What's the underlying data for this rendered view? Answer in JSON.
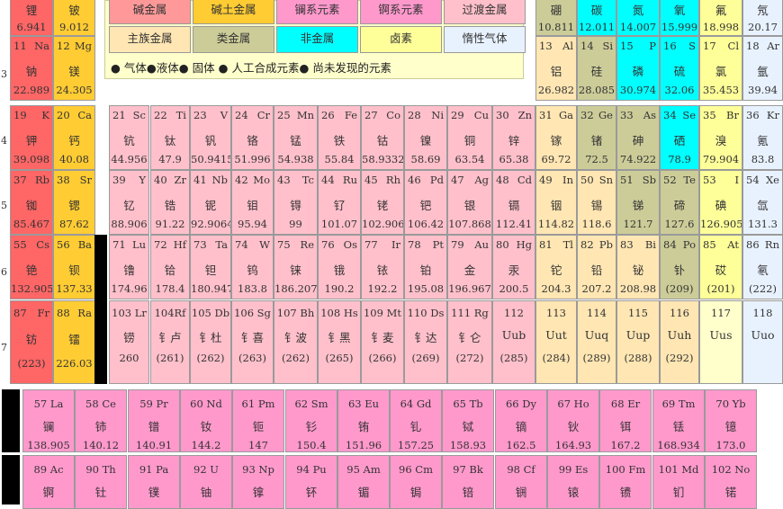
{
  "colors": {
    "alkali": "#ff9999",
    "alkaline_earth": "#ffcc33",
    "lanthanide": "#ff99cc",
    "actinide": "#ff99cc",
    "transition": "#ffc0cb",
    "post_transition": "#ccccaa",
    "metalloid": "#cccc99",
    "nonmetal": "#00ffff",
    "halogen": "#ffff99",
    "noble": "#c0e0ff",
    "hydrogen_yellow": "#ffffcc",
    "undiscovered": "#ffe6b3",
    "bottom_row": "#ff99cc"
  },
  "legend": {
    "categories": [
      {
        "label": "碱金属",
        "color": "#ff9999"
      },
      {
        "label": "碱土金属",
        "color": "#ffcc33"
      },
      {
        "label": "镧系元素",
        "color": "#ff99cc"
      },
      {
        "label": "锕系元素",
        "color": "#ff99cc"
      },
      {
        "label": "过渡金属",
        "color": "#ffc0cb"
      },
      {
        "label": "主族金属",
        "color": "#ffe6b3"
      },
      {
        "label": "类金属",
        "color": "#cccc99"
      },
      {
        "label": "非金属",
        "color": "#00ffff"
      },
      {
        "label": "卤素",
        "color": "#ffff99"
      },
      {
        "label": "惰性气体",
        "color": "#e8f2ff"
      }
    ],
    "states_text": "● 气体●液体●  固体  ●  人工合成元素●  尚未发现的元素"
  },
  "row_labels": [
    "3",
    "4",
    "5",
    "6",
    "7"
  ],
  "top_partial": [
    {
      "name": "锂",
      "mass": "6.941",
      "color": "#ff6666"
    },
    {
      "name": "铍",
      "mass": "9.012",
      "color": "#ffcc33"
    },
    {
      "name": "硼",
      "mass": "10.811",
      "color": "#cccc99"
    },
    {
      "name": "碳",
      "mass": "12.011",
      "color": "#00ffff"
    },
    {
      "name": "氮",
      "mass": "14.007",
      "color": "#00ffff"
    },
    {
      "name": "氧",
      "mass": "15.999",
      "color": "#00ffff"
    },
    {
      "name": "氟",
      "mass": "18.998",
      "color": "#ffff99"
    },
    {
      "name": "氖",
      "mass": "20.17",
      "color": "#e8f2ff"
    }
  ],
  "period3": [
    {
      "num": "11",
      "sym": "Na",
      "name": "钠",
      "mass": "22.989",
      "color": "#ff6666"
    },
    {
      "num": "12",
      "sym": "Mg",
      "name": "镁",
      "mass": "24.305",
      "color": "#ffcc33"
    },
    {
      "num": "13",
      "sym": "Al",
      "name": "铝",
      "mass": "26.982",
      "color": "#ffe6b3"
    },
    {
      "num": "14",
      "sym": "Si",
      "name": "硅",
      "mass": "28.085",
      "color": "#cccc99"
    },
    {
      "num": "15",
      "sym": "P",
      "name": "磷",
      "mass": "30.974",
      "color": "#00ffff"
    },
    {
      "num": "16",
      "sym": "S",
      "name": "硫",
      "mass": "32.06",
      "color": "#00ffff"
    },
    {
      "num": "17",
      "sym": "Cl",
      "name": "氯",
      "mass": "35.453",
      "color": "#ffff99"
    },
    {
      "num": "18",
      "sym": "Ar",
      "name": "氩",
      "mass": "39.94",
      "color": "#e8f2ff"
    }
  ],
  "period4": [
    {
      "num": "19",
      "sym": "K",
      "name": "钾",
      "mass": "39.098",
      "color": "#ff6666"
    },
    {
      "num": "20",
      "sym": "Ca",
      "name": "钙",
      "mass": "40.08",
      "color": "#ffcc33"
    },
    {
      "num": "21",
      "sym": "Sc",
      "name": "钪",
      "mass": "44.956",
      "color": "#ffc0cb"
    },
    {
      "num": "22",
      "sym": "Ti",
      "name": "钛",
      "mass": "47.9",
      "color": "#ffc0cb"
    },
    {
      "num": "23",
      "sym": "V",
      "name": "钒",
      "mass": "50.9415",
      "color": "#ffc0cb"
    },
    {
      "num": "24",
      "sym": "Cr",
      "name": "铬",
      "mass": "51.996",
      "color": "#ffc0cb"
    },
    {
      "num": "25",
      "sym": "Mn",
      "name": "锰",
      "mass": "54.938",
      "color": "#ffc0cb"
    },
    {
      "num": "26",
      "sym": "Fe",
      "name": "铁",
      "mass": "55.84",
      "color": "#ffc0cb"
    },
    {
      "num": "27",
      "sym": "Co",
      "name": "钴",
      "mass": "58.9332",
      "color": "#ffc0cb"
    },
    {
      "num": "28",
      "sym": "Ni",
      "name": "镍",
      "mass": "58.69",
      "color": "#ffc0cb"
    },
    {
      "num": "29",
      "sym": "Cu",
      "name": "铜",
      "mass": "63.54",
      "color": "#ffc0cb"
    },
    {
      "num": "30",
      "sym": "Zn",
      "name": "锌",
      "mass": "65.38",
      "color": "#ffc0cb"
    },
    {
      "num": "31",
      "sym": "Ga",
      "name": "镓",
      "mass": "69.72",
      "color": "#ffe6b3"
    },
    {
      "num": "32",
      "sym": "Ge",
      "name": "锗",
      "mass": "72.5",
      "color": "#cccc99"
    },
    {
      "num": "33",
      "sym": "As",
      "name": "砷",
      "mass": "74.922",
      "color": "#cccc99"
    },
    {
      "num": "34",
      "sym": "Se",
      "name": "硒",
      "mass": "78.9",
      "color": "#00ffff"
    },
    {
      "num": "35",
      "sym": "Br",
      "name": "溴",
      "mass": "79.904",
      "color": "#ffff99"
    },
    {
      "num": "36",
      "sym": "Kr",
      "name": "氪",
      "mass": "83.8",
      "color": "#e8f2ff"
    }
  ],
  "period5": [
    {
      "num": "37",
      "sym": "Rb",
      "name": "铷",
      "mass": "85.467",
      "color": "#ff6666"
    },
    {
      "num": "38",
      "sym": "Sr",
      "name": "锶",
      "mass": "87.62",
      "color": "#ffcc33"
    },
    {
      "num": "39",
      "sym": "Y",
      "name": "钇",
      "mass": "88.906",
      "color": "#ffc0cb"
    },
    {
      "num": "40",
      "sym": "Zr",
      "name": "锆",
      "mass": "91.22",
      "color": "#ffc0cb"
    },
    {
      "num": "41",
      "sym": "Nb",
      "name": "铌",
      "mass": "92.9064",
      "color": "#ffc0cb"
    },
    {
      "num": "42",
      "sym": "Mo",
      "name": "钼",
      "mass": "95.94",
      "color": "#ffc0cb"
    },
    {
      "num": "43",
      "sym": "Tc",
      "name": "锝",
      "mass": "99",
      "color": "#ffc0cb"
    },
    {
      "num": "44",
      "sym": "Ru",
      "name": "钌",
      "mass": "101.07",
      "color": "#ffc0cb"
    },
    {
      "num": "45",
      "sym": "Rh",
      "name": "铑",
      "mass": "102.906",
      "color": "#ffc0cb"
    },
    {
      "num": "46",
      "sym": "Pd",
      "name": "钯",
      "mass": "106.42",
      "color": "#ffc0cb"
    },
    {
      "num": "47",
      "sym": "Ag",
      "name": "银",
      "mass": "107.868",
      "color": "#ffc0cb"
    },
    {
      "num": "48",
      "sym": "Cd",
      "name": "镉",
      "mass": "112.41",
      "color": "#ffc0cb"
    },
    {
      "num": "49",
      "sym": "In",
      "name": "铟",
      "mass": "114.82",
      "color": "#ffe6b3"
    },
    {
      "num": "50",
      "sym": "Sn",
      "name": "锡",
      "mass": "118.6",
      "color": "#ffe6b3"
    },
    {
      "num": "51",
      "sym": "Sb",
      "name": "锑",
      "mass": "121.7",
      "color": "#cccc99"
    },
    {
      "num": "52",
      "sym": "Te",
      "name": "碲",
      "mass": "127.6",
      "color": "#cccc99"
    },
    {
      "num": "53",
      "sym": "I",
      "name": "碘",
      "mass": "126.905",
      "color": "#ffff99"
    },
    {
      "num": "54",
      "sym": "Xe",
      "name": "氙",
      "mass": "131.3",
      "color": "#e8f2ff"
    }
  ],
  "period6": [
    {
      "num": "55",
      "sym": "Cs",
      "name": "铯",
      "mass": "132.905",
      "color": "#ff6666"
    },
    {
      "num": "56",
      "sym": "Ba",
      "name": "钡",
      "mass": "137.33",
      "color": "#ffcc33"
    },
    {
      "num": "71",
      "sym": "Lu",
      "name": "镥",
      "mass": "174.96",
      "color": "#ffc0cb"
    },
    {
      "num": "72",
      "sym": "Hf",
      "name": "铪",
      "mass": "178.4",
      "color": "#ffc0cb"
    },
    {
      "num": "73",
      "sym": "Ta",
      "name": "钽",
      "mass": "180.947",
      "color": "#ffc0cb"
    },
    {
      "num": "74",
      "sym": "W",
      "name": "钨",
      "mass": "183.8",
      "color": "#ffc0cb"
    },
    {
      "num": "75",
      "sym": "Re",
      "name": "铼",
      "mass": "186.207",
      "color": "#ffc0cb"
    },
    {
      "num": "76",
      "sym": "Os",
      "name": "锇",
      "mass": "190.2",
      "color": "#ffc0cb"
    },
    {
      "num": "77",
      "sym": "Ir",
      "name": "铱",
      "mass": "192.2",
      "color": "#ffc0cb"
    },
    {
      "num": "78",
      "sym": "Pt",
      "name": "铂",
      "mass": "195.08",
      "color": "#ffc0cb"
    },
    {
      "num": "79",
      "sym": "Au",
      "name": "金",
      "mass": "196.967",
      "color": "#ffc0cb"
    },
    {
      "num": "80",
      "sym": "Hg",
      "name": "汞",
      "mass": "200.5",
      "color": "#ffc0cb"
    },
    {
      "num": "81",
      "sym": "Tl",
      "name": "铊",
      "mass": "204.3",
      "color": "#ffe6b3"
    },
    {
      "num": "82",
      "sym": "Pb",
      "name": "铅",
      "mass": "207.2",
      "color": "#ffe6b3"
    },
    {
      "num": "83",
      "sym": "Bi",
      "name": "铋",
      "mass": "208.98",
      "color": "#ffe6b3"
    },
    {
      "num": "84",
      "sym": "Po",
      "name": "钋",
      "mass": "(209)",
      "color": "#cccc99"
    },
    {
      "num": "85",
      "sym": "At",
      "name": "砹",
      "mass": "(201)",
      "color": "#ffff99"
    },
    {
      "num": "86",
      "sym": "Rn",
      "name": "氡",
      "mass": "(222)",
      "color": "#e8f2ff"
    }
  ],
  "period7": [
    {
      "num": "87",
      "sym": "Fr",
      "name": "钫",
      "mass": "(223)",
      "color": "#ff6666"
    },
    {
      "num": "88",
      "sym": "Ra",
      "name": "镭",
      "mass": "226.03",
      "color": "#ffcc33"
    },
    {
      "num": "103 Lr",
      "sym": "",
      "name": "铹",
      "mass": "260",
      "color": "#ffc0cb"
    },
    {
      "num": "104Rf",
      "sym": "",
      "name": "钅卢",
      "mass": "(261)",
      "color": "#ffc0cb"
    },
    {
      "num": "105 Db",
      "sym": "",
      "name": "钅杜",
      "mass": "(262)",
      "color": "#ffc0cb"
    },
    {
      "num": "106 Sg",
      "sym": "",
      "name": "钅喜",
      "mass": "(263)",
      "color": "#ffc0cb"
    },
    {
      "num": "107 Bh",
      "sym": "",
      "name": "钅波",
      "mass": "(262)",
      "color": "#ffc0cb"
    },
    {
      "num": "108 Hs",
      "sym": "",
      "name": "钅黑",
      "mass": "(265)",
      "color": "#ffc0cb"
    },
    {
      "num": "109 Mt",
      "sym": "",
      "name": "钅麦",
      "mass": "(266)",
      "color": "#ffc0cb"
    },
    {
      "num": "110 Ds",
      "sym": "",
      "name": "钅达",
      "mass": "(269)",
      "color": "#ffc0cb"
    },
    {
      "num": "111 Rg",
      "sym": "",
      "name": "钅仑",
      "mass": "(272)",
      "color": "#ffc0cb"
    },
    {
      "num": "112",
      "sym": "",
      "name": "Uub",
      "mass": "(285)",
      "color": "#ffc0cb"
    },
    {
      "num": "113",
      "sym": "",
      "name": "Uut",
      "mass": "(284)",
      "color": "#ffe6b3"
    },
    {
      "num": "114",
      "sym": "",
      "name": "Uuq",
      "mass": "(289)",
      "color": "#ffe6b3"
    },
    {
      "num": "115",
      "sym": "",
      "name": "Uup",
      "mass": "(288)",
      "color": "#ffe6b3"
    },
    {
      "num": "116",
      "sym": "",
      "name": "Uuh",
      "mass": "(292)",
      "color": "#ffe6b3"
    },
    {
      "num": "117",
      "sym": "",
      "name": "Uus",
      "mass": "",
      "color": "#ffffcc"
    },
    {
      "num": "118",
      "sym": "",
      "name": "Uuo",
      "mass": "",
      "color": "#e8f2ff"
    }
  ],
  "lanthanides": [
    {
      "num": "57 La",
      "name": "镧",
      "mass": "138.905"
    },
    {
      "num": "58 Ce",
      "name": "铈",
      "mass": "140.12"
    },
    {
      "num": "59 Pr",
      "name": "镨",
      "mass": "140.91"
    },
    {
      "num": "60 Nd",
      "name": "钕",
      "mass": "144.2"
    },
    {
      "num": "61 Pm",
      "name": "钷",
      "mass": "147"
    },
    {
      "num": "62 Sm",
      "name": "钐",
      "mass": "150.4"
    },
    {
      "num": "63 Eu",
      "name": "铕",
      "mass": "151.96"
    },
    {
      "num": "64 Gd",
      "name": "钆",
      "mass": "157.25"
    },
    {
      "num": "65 Tb",
      "name": "铽",
      "mass": "158.93"
    },
    {
      "num": "66 Dy",
      "name": "镝",
      "mass": "162.5"
    },
    {
      "num": "67 Ho",
      "name": "钬",
      "mass": "164.93"
    },
    {
      "num": "68 Er",
      "name": "铒",
      "mass": "167.2"
    },
    {
      "num": "69 Tm",
      "name": "铥",
      "mass": "168.934"
    },
    {
      "num": "70 Yb",
      "name": "镱",
      "mass": "173.0"
    }
  ],
  "actinides": [
    {
      "num": "89 Ac",
      "name": "锕",
      "mass": ""
    },
    {
      "num": "90 Th",
      "name": "钍",
      "mass": ""
    },
    {
      "num": "91 Pa",
      "name": "镤",
      "mass": ""
    },
    {
      "num": "92 U",
      "name": "铀",
      "mass": ""
    },
    {
      "num": "93 Np",
      "name": "镎",
      "mass": ""
    },
    {
      "num": "94 Pu",
      "name": "钚",
      "mass": ""
    },
    {
      "num": "95 Am",
      "name": "镅",
      "mass": ""
    },
    {
      "num": "96 Cm",
      "name": "锔",
      "mass": ""
    },
    {
      "num": "97 Bk",
      "name": "锫",
      "mass": ""
    },
    {
      "num": "98 Cf",
      "name": "锎",
      "mass": ""
    },
    {
      "num": "99 Es",
      "name": "锿",
      "mass": ""
    },
    {
      "num": "100 Fm",
      "name": "镄",
      "mass": ""
    },
    {
      "num": "101 Md",
      "name": "钔",
      "mass": ""
    },
    {
      "num": "102 No",
      "name": "锘",
      "mass": ""
    }
  ]
}
